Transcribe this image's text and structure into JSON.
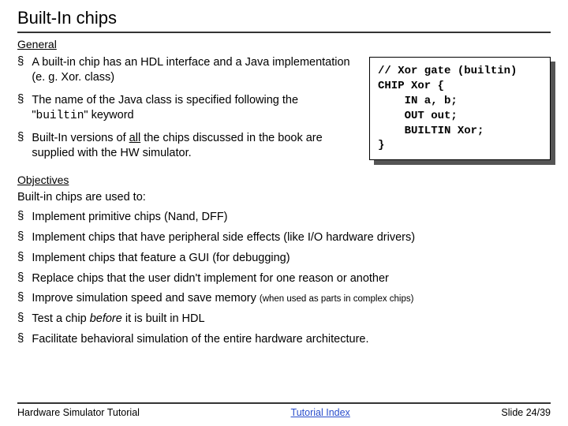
{
  "title": "Built-In chips",
  "sections": {
    "general_head": "General",
    "objectives_head": "Objectives",
    "intro": "Built-in chips are used to:"
  },
  "general": [
    {
      "pre": "A built-in chip has an HDL interface and a Java implementation (e. g. Xor. class)"
    },
    {
      "pre": "The name of the Java class is specified following the \"",
      "code": "builtin",
      "post": "\" keyword"
    },
    {
      "pre": "Built-In versions of ",
      "u": "all",
      "post": " the chips discussed in the book are supplied with the HW simulator."
    }
  ],
  "code": {
    "l1": "// Xor gate (builtin)",
    "l2": "CHIP Xor {",
    "l3": "    IN a, b;",
    "l4": "    OUT out;",
    "l5": "    BUILTIN Xor;",
    "l6": "}"
  },
  "objectives": [
    {
      "text": "Implement primitive chips (Nand, DFF)"
    },
    {
      "text": "Implement chips that have peripheral side effects (like I/O hardware drivers)"
    },
    {
      "text": "Implement chips that feature a GUI (for debugging)"
    },
    {
      "text": "Replace chips that the user didn't implement for one reason or another"
    },
    {
      "text": "Improve simulation speed and save memory ",
      "small": "(when used as parts in complex chips)"
    },
    {
      "pre": "Test a chip ",
      "em": "before",
      "post": " it is built in HDL"
    },
    {
      "text": "Facilitate behavioral simulation of the entire hardware architecture."
    }
  ],
  "footer": {
    "left": "Hardware Simulator Tutorial",
    "center": "Tutorial Index",
    "right": "Slide 24/39"
  }
}
